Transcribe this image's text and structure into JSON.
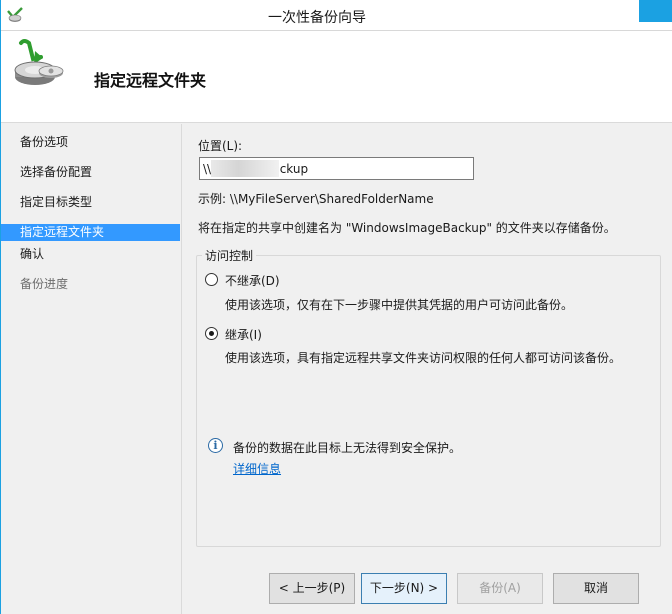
{
  "window": {
    "title": "一次性备份向导"
  },
  "header": {
    "title": "指定远程文件夹",
    "icon": "backup-disk-icon"
  },
  "nav": {
    "items": [
      {
        "label": "备份选项",
        "state": "normal"
      },
      {
        "label": "选择备份配置",
        "state": "normal"
      },
      {
        "label": "指定目标类型",
        "state": "normal"
      },
      {
        "label": "指定远程文件夹",
        "state": "selected"
      },
      {
        "label": "确认",
        "state": "normal"
      },
      {
        "label": "备份进度",
        "state": "disabled"
      }
    ]
  },
  "content": {
    "location_label": "位置(L):",
    "location_value": "\\\\1           \\backup",
    "example_text": "示例: \\\\MyFileServer\\SharedFolderName",
    "description": "将在指定的共享中创建名为 \"WindowsImageBackup\" 的文件夹以存储备份。",
    "access_group": {
      "legend": "访问控制",
      "options": [
        {
          "label": "不继承(D)",
          "description": "使用该选项，仅有在下一步骤中提供其凭据的用户可访问此备份。",
          "checked": false
        },
        {
          "label": "继承(I)",
          "description": "使用该选项，具有指定远程共享文件夹访问权限的任何人都可访问该备份。",
          "checked": true
        }
      ]
    },
    "warning_text": "备份的数据在此目标上无法得到安全保护。",
    "more_info_link": "详细信息"
  },
  "footer": {
    "prev_label": "< 上一步(P)",
    "next_label": "下一步(N) >",
    "backup_label": "备份(A)",
    "cancel_label": "取消"
  },
  "colors": {
    "accent": "#1ba1e2",
    "selection": "#3399ff",
    "link": "#0066cc"
  }
}
